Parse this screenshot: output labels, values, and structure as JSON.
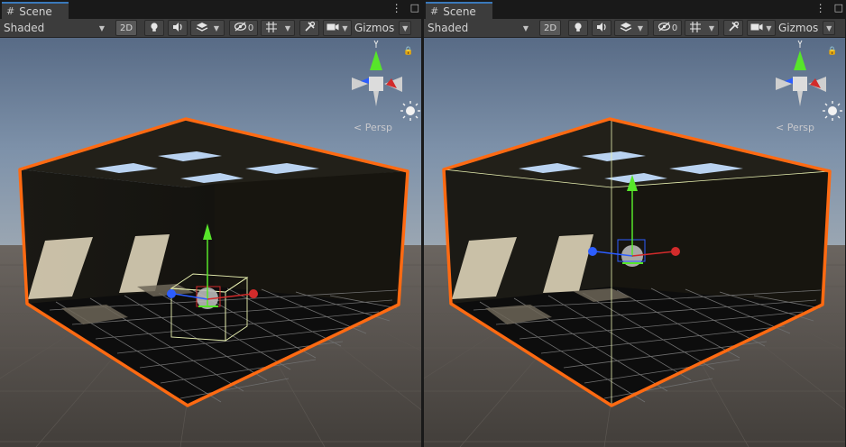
{
  "panels": [
    {
      "id": "left",
      "tab": {
        "icon": "hash-icon",
        "label": "Scene"
      },
      "toolbar": {
        "draw_mode": "Shaded",
        "mode_2d": "2D",
        "hidden_count": "0",
        "gizmos": "Gizmos"
      },
      "orientation_label": "Persp"
    },
    {
      "id": "right",
      "tab": {
        "icon": "hash-icon",
        "label": "Scene"
      },
      "toolbar": {
        "draw_mode": "Shaded",
        "mode_2d": "2D",
        "hidden_count": "0",
        "gizmos": "Gizmos"
      },
      "orientation_label": "Persp"
    }
  ],
  "colors": {
    "selection_outline": "#ff6a12",
    "x_axis": "#d22b2b",
    "y_axis": "#57e52a",
    "z_axis": "#2c5dff",
    "sky": "#7e92aa",
    "ground": "#4a4541"
  }
}
